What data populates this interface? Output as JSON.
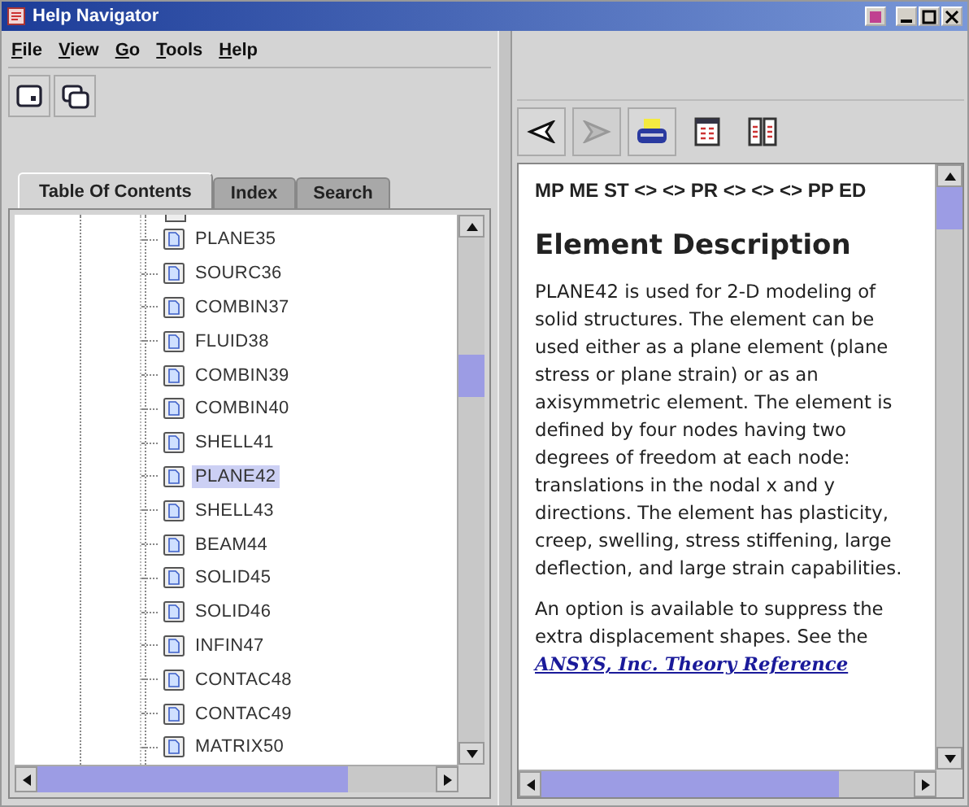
{
  "window": {
    "title": "Help Navigator"
  },
  "menu": [
    "File",
    "View",
    "Go",
    "Tools",
    "Help"
  ],
  "tabs": [
    {
      "label": "Table Of Contents",
      "selected": true
    },
    {
      "label": "Index",
      "selected": false
    },
    {
      "label": "Search",
      "selected": false
    }
  ],
  "tree": [
    {
      "label": "PLANE35",
      "selected": false
    },
    {
      "label": "SOURC36",
      "selected": false
    },
    {
      "label": "COMBIN37",
      "selected": false
    },
    {
      "label": "FLUID38",
      "selected": false
    },
    {
      "label": "COMBIN39",
      "selected": false
    },
    {
      "label": "COMBIN40",
      "selected": false
    },
    {
      "label": "SHELL41",
      "selected": false
    },
    {
      "label": "PLANE42",
      "selected": true
    },
    {
      "label": "SHELL43",
      "selected": false
    },
    {
      "label": "BEAM44",
      "selected": false
    },
    {
      "label": "SOLID45",
      "selected": false
    },
    {
      "label": "SOLID46",
      "selected": false
    },
    {
      "label": "INFIN47",
      "selected": false
    },
    {
      "label": "CONTAC48",
      "selected": false
    },
    {
      "label": "CONTAC49",
      "selected": false
    },
    {
      "label": "MATRIX50",
      "selected": false
    }
  ],
  "nav_buttons": [
    {
      "kind": "back",
      "disabled": false
    },
    {
      "kind": "forward",
      "disabled": true
    }
  ],
  "content": {
    "nav_line": "MP ME ST <> <> PR <> <> <> PP ED",
    "heading": "Element Description",
    "paragraph": "PLANE42 is used for 2-D modeling of solid structures. The element can be used either as a plane element (plane stress or plane strain) or as an axisymmetric element. The element is defined by four nodes having two degrees of freedom at each node: translations in the nodal x and y directions. The element has plasticity, creep, swelling, stress stiffening, large deflection, and large strain capabilities.",
    "note": "An option is available to suppress the extra displacement shapes. See the",
    "link": "ANSYS, Inc. Theory Reference"
  }
}
